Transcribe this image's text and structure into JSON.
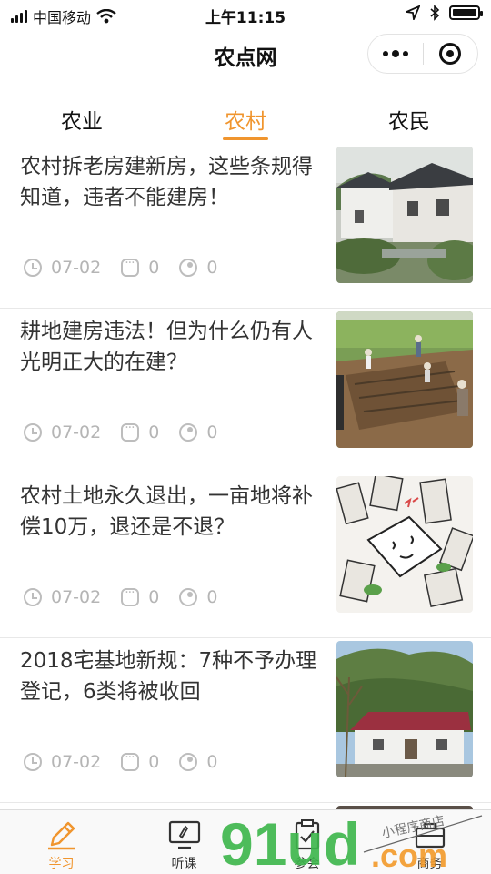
{
  "status_bar": {
    "carrier": "中国移动",
    "time": "上午11:15"
  },
  "nav": {
    "title": "农点网"
  },
  "tabs": [
    {
      "label": "农业",
      "active": false
    },
    {
      "label": "农村",
      "active": true
    },
    {
      "label": "农民",
      "active": false
    }
  ],
  "articles": [
    {
      "title": "农村拆老房建新房，这些条规得知道，违者不能建房！",
      "date": "07-02",
      "comments": "0",
      "views": "0",
      "thumb": "village-houses-photo"
    },
    {
      "title": "耕地建房违法！但为什么仍有人光明正大的在建？",
      "date": "07-02",
      "comments": "0",
      "views": "0",
      "thumb": "farmland-construction-photo"
    },
    {
      "title": "农村土地永久退出，一亩地将补偿10万，退还是不退？",
      "date": "07-02",
      "comments": "0",
      "views": "0",
      "thumb": "cartoon-illustration"
    },
    {
      "title": "2018宅基地新规：7种不予办理登记，6类将被收回",
      "date": "07-02",
      "comments": "0",
      "views": "0",
      "thumb": "rural-house-photo"
    }
  ],
  "tabbar": [
    {
      "label": "学习",
      "icon": "pencil-icon",
      "active": true
    },
    {
      "label": "听课",
      "icon": "monitor-icon",
      "active": false
    },
    {
      "label": "参会",
      "icon": "clipboard-icon",
      "active": false
    },
    {
      "label": "商务",
      "icon": "briefcase-icon",
      "active": false
    }
  ],
  "watermark": {
    "text": "91ud.com",
    "small_text": "小程序商店"
  },
  "colors": {
    "accent": "#f0952e",
    "watermark_green": "#3cb64b",
    "watermark_orange": "#f39a2a"
  }
}
